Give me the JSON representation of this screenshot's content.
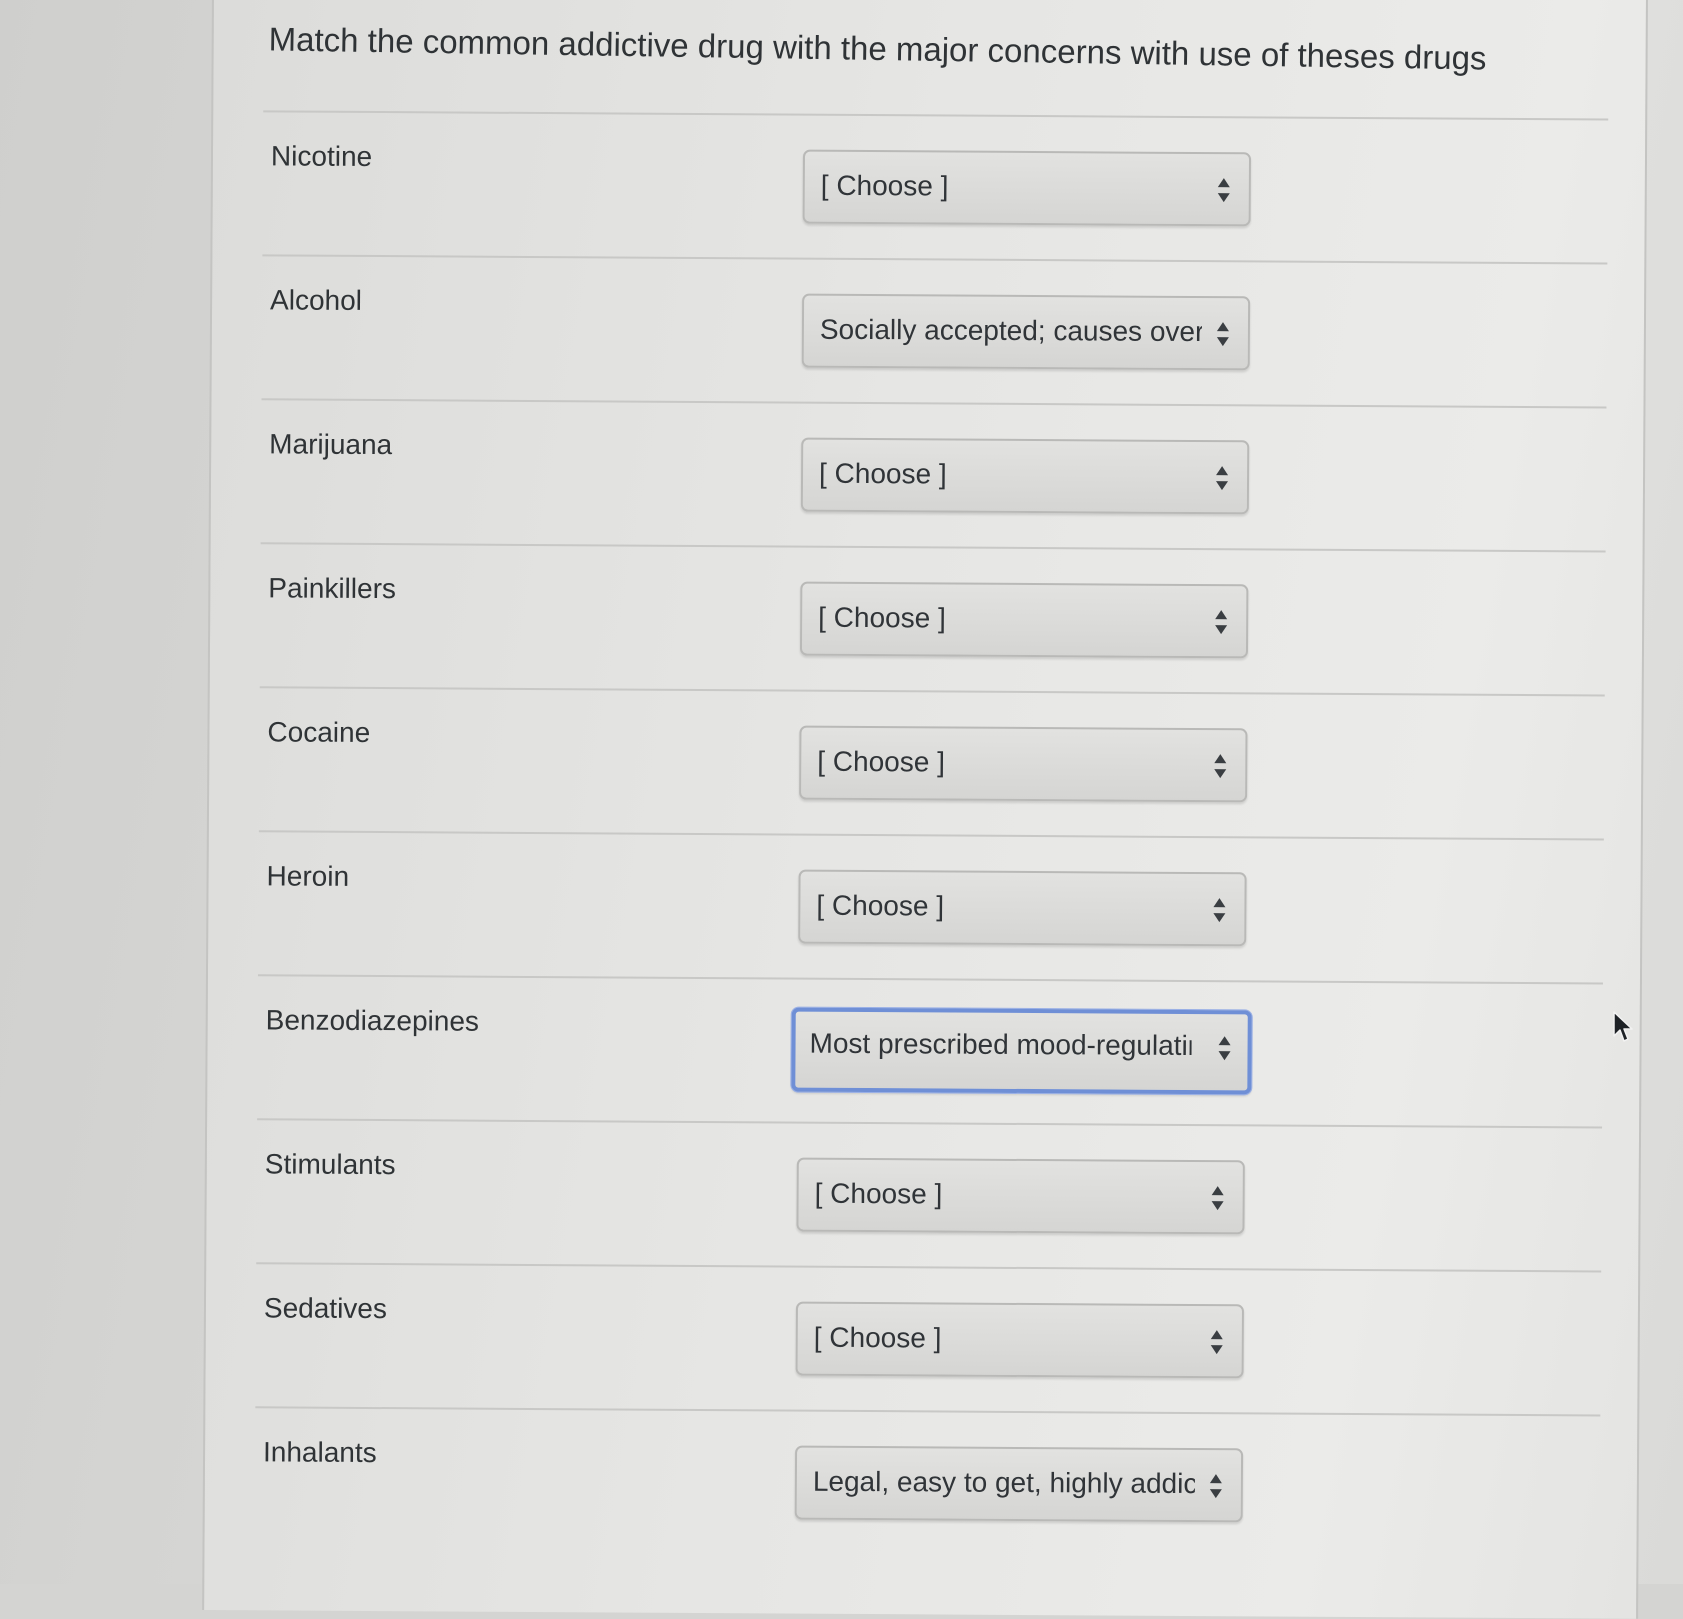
{
  "question": {
    "title": "Match the common addictive drug with the major concerns with use of theses drugs"
  },
  "rows": [
    {
      "label": "Nicotine",
      "selected": "[ Choose ]",
      "focused": false
    },
    {
      "label": "Alcohol",
      "selected": "Socially accepted; causes overdose",
      "focused": false
    },
    {
      "label": "Marijuana",
      "selected": "[ Choose ]",
      "focused": false
    },
    {
      "label": "Painkillers",
      "selected": "[ Choose ]",
      "focused": false
    },
    {
      "label": "Cocaine",
      "selected": "[ Choose ]",
      "focused": false
    },
    {
      "label": "Heroin",
      "selected": "[ Choose ]",
      "focused": false
    },
    {
      "label": "Benzodiazepines",
      "selected": "Most prescribed mood-regulating",
      "focused": true
    },
    {
      "label": "Stimulants",
      "selected": "[ Choose ]",
      "focused": false
    },
    {
      "label": "Sedatives",
      "selected": "[ Choose ]",
      "focused": false
    },
    {
      "label": "Inhalants",
      "selected": "Legal, easy to get, highly addictive",
      "focused": false
    }
  ],
  "icons": {
    "select_arrows": "up-down-chevron-icon",
    "cursor": "mouse-pointer-icon"
  },
  "colors": {
    "focus_ring": "#6f8fd6",
    "text": "#2f3336"
  }
}
